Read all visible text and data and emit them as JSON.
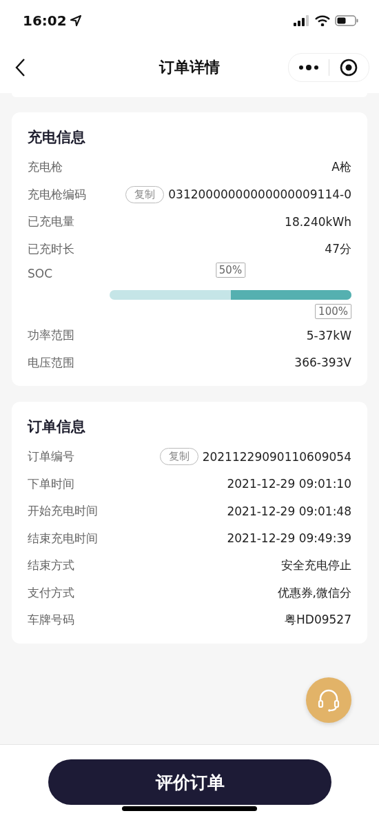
{
  "status_bar": {
    "time": "16:02"
  },
  "nav": {
    "title": "订单详情"
  },
  "charging_info": {
    "title": "充电信息",
    "rows": [
      {
        "kind": "text",
        "label": "充电枪",
        "value": "A枪"
      },
      {
        "kind": "copy",
        "label": "充电枪编码",
        "copy": "复制",
        "value": "03120000000000000009114-0"
      },
      {
        "kind": "text",
        "label": "已充电量",
        "value": "18.240kWh"
      },
      {
        "kind": "text",
        "label": "已充时长",
        "value": "47分"
      },
      {
        "kind": "soc",
        "label": "SOC",
        "start_label": "50%",
        "end_label": "100%",
        "level": 0.5
      },
      {
        "kind": "text",
        "label": "功率范围",
        "value": "5-37kW"
      },
      {
        "kind": "text",
        "label": "电压范围",
        "value": "366-393V"
      }
    ]
  },
  "order_info": {
    "title": "订单信息",
    "rows": [
      {
        "kind": "copy",
        "label": "订单编号",
        "copy": "复制",
        "value": "20211229090110609054"
      },
      {
        "kind": "text",
        "label": "下单时间",
        "value": "2021-12-29 09:01:10"
      },
      {
        "kind": "text",
        "label": "开始充电时间",
        "value": "2021-12-29 09:01:48"
      },
      {
        "kind": "text",
        "label": "结束充电时间",
        "value": "2021-12-29 09:49:39"
      },
      {
        "kind": "text",
        "label": "结束方式",
        "value": "安全充电停止"
      },
      {
        "kind": "text",
        "label": "支付方式",
        "value": "优惠券,微信分"
      },
      {
        "kind": "text",
        "label": "车牌号码",
        "value": "粤HD09527"
      }
    ]
  },
  "action_button": "评价订单"
}
